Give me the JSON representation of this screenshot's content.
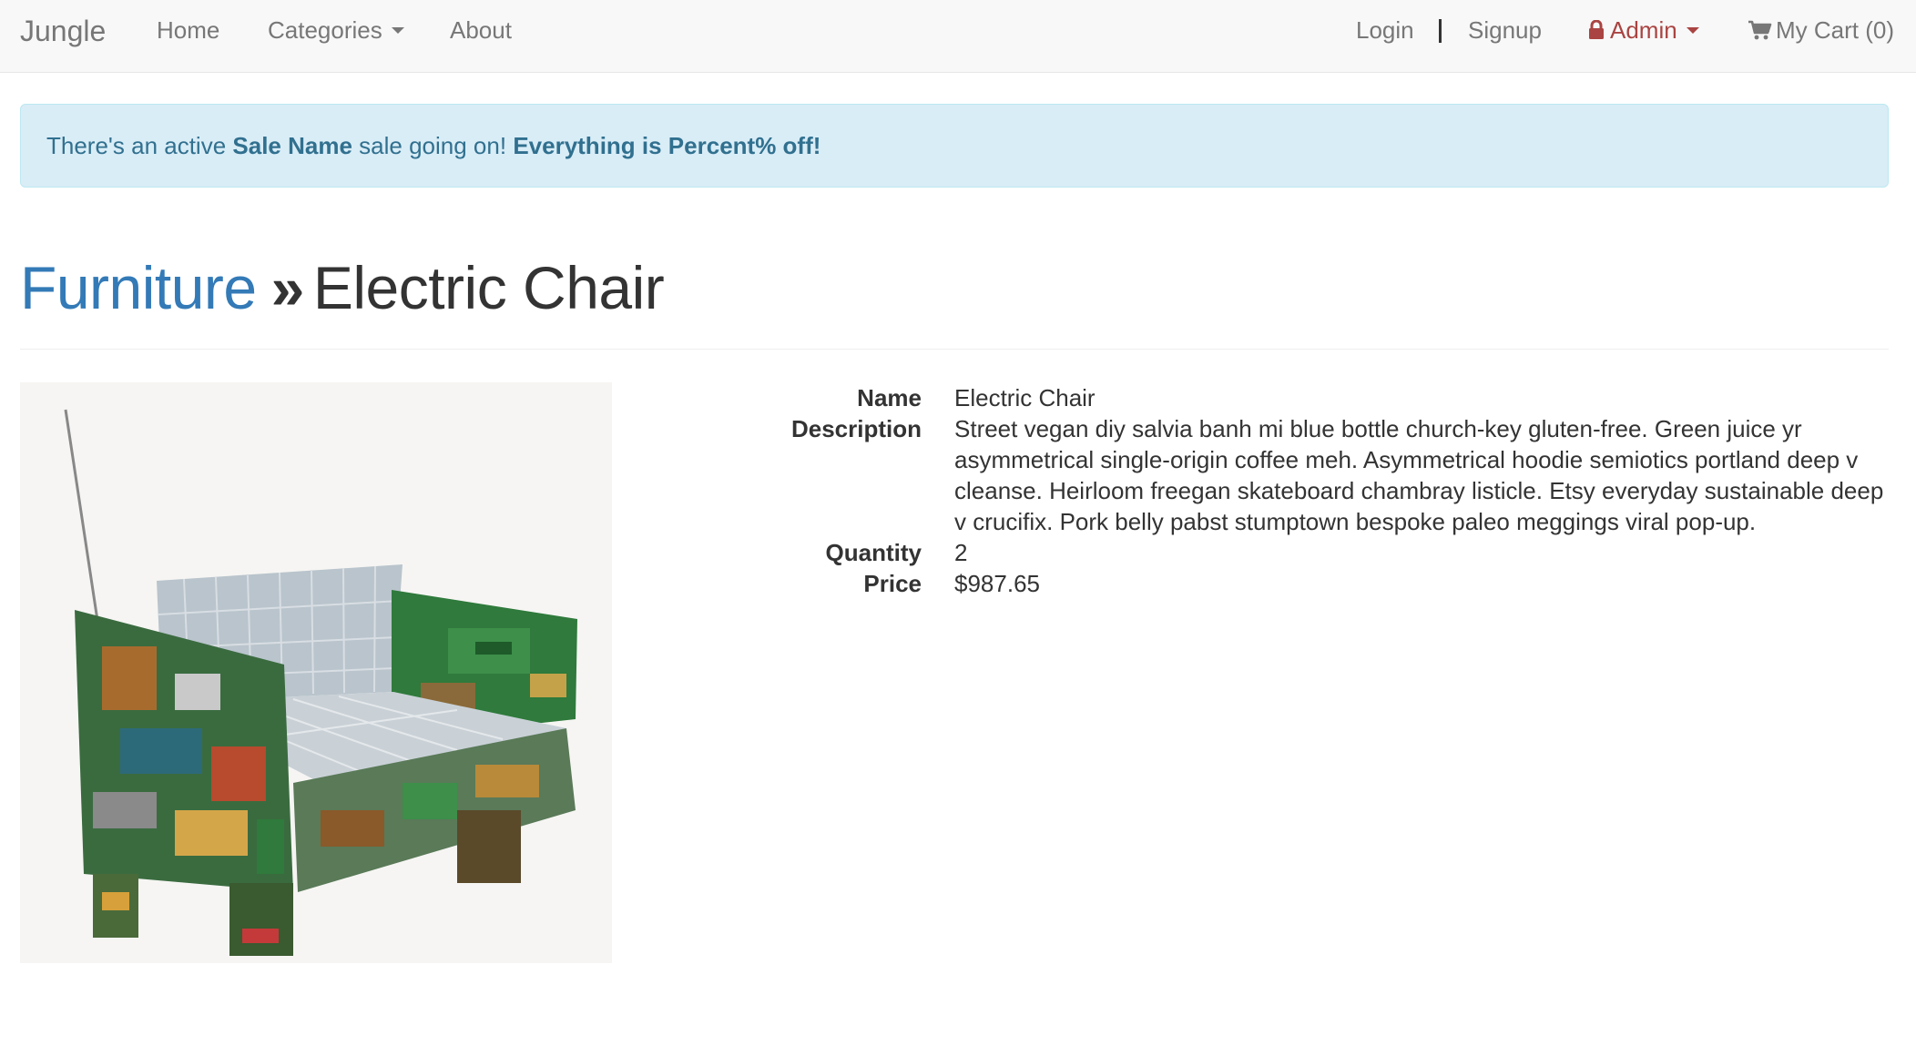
{
  "navbar": {
    "brand": "Jungle",
    "home": "Home",
    "categories": "Categories",
    "about": "About",
    "login": "Login",
    "signup": "Signup",
    "admin": "Admin",
    "cart": "My Cart (0)"
  },
  "alert": {
    "prefix": "There's an active",
    "sale_name": "Sale Name",
    "middle": "sale going on!",
    "emphasis": "Everything is Percent% off!"
  },
  "breadcrumb": {
    "category": "Furniture",
    "separator": "»",
    "product": "Electric Chair"
  },
  "product": {
    "labels": {
      "name": "Name",
      "description": "Description",
      "quantity": "Quantity",
      "price": "Price"
    },
    "name": "Electric Chair",
    "description": "Street vegan diy salvia banh mi blue bottle church-key gluten-free. Green juice yr asymmetrical single-origin coffee meh. Asymmetrical hoodie semiotics portland deep v cleanse. Heirloom freegan skateboard chambray listicle. Etsy everyday sustainable deep v crucifix. Pork belly pabst stumptown bespoke paleo meggings viral pop-up.",
    "quantity": "2",
    "price": "$987.65"
  },
  "colors": {
    "link": "#337ab7",
    "admin": "#a94442",
    "alert_bg": "#d9edf7",
    "alert_text": "#31708f"
  }
}
